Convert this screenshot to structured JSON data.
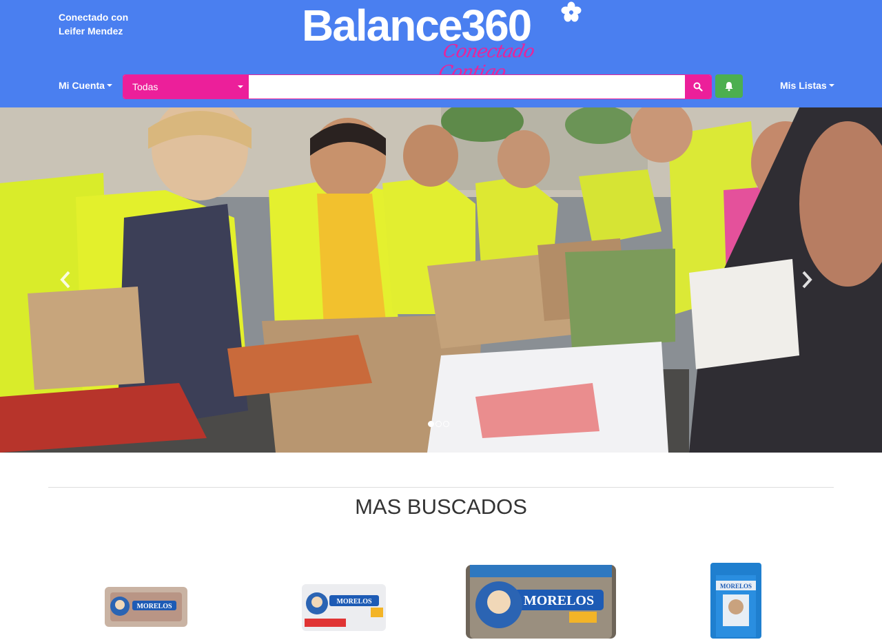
{
  "header": {
    "connected_line1": "Conectado con",
    "connected_line2": "Leifer Mendez",
    "logo_main": "Balance360",
    "logo_tagline": "Conectado Contigo",
    "bg_color": "#4a7ff0",
    "accent_color": "#ec1f9a"
  },
  "nav": {
    "account_label": "Mi Cuenta",
    "lists_label": "Mis Listas"
  },
  "search": {
    "category_selected": "Todas",
    "placeholder": "",
    "search_icon": "search-icon",
    "bell_icon": "bell-icon"
  },
  "carousel": {
    "slide_count": 3,
    "active_index": 0
  },
  "section": {
    "title": "MAS BUSCADOS"
  },
  "products": [
    {
      "brand": "MORELOS"
    },
    {
      "brand": "MORELOS"
    },
    {
      "brand": "MORELOS"
    },
    {
      "brand": "MORELOS"
    }
  ]
}
